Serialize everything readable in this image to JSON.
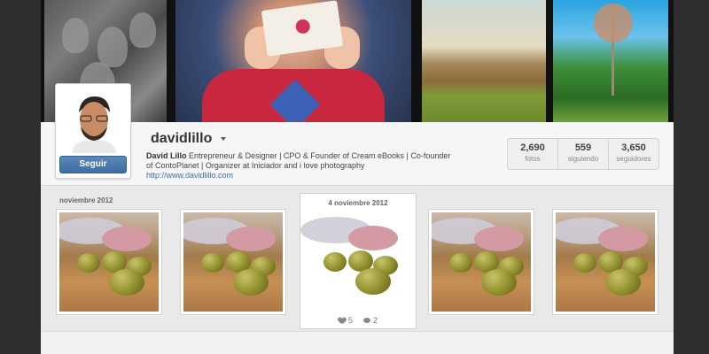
{
  "profile": {
    "username": "davidlillo",
    "follow_label": "Seguir",
    "bio_name": "David Lillo",
    "bio_text": "Entrepreneur & Designer | CPO & Founder of Cream eBooks | Co-founder of ContoPlanet | Organizer at Iniciador and i love photography",
    "website": "http://www.davidlillo.com"
  },
  "stats": [
    {
      "value": "2,690",
      "label": "fotos"
    },
    {
      "value": "559",
      "label": "siguiendo"
    },
    {
      "value": "3,650",
      "label": "seguidores"
    }
  ],
  "grid": {
    "month_label": "noviembre 2012",
    "featured": {
      "date": "4 noviembre 2012",
      "likes": "5",
      "comments": "2"
    }
  }
}
